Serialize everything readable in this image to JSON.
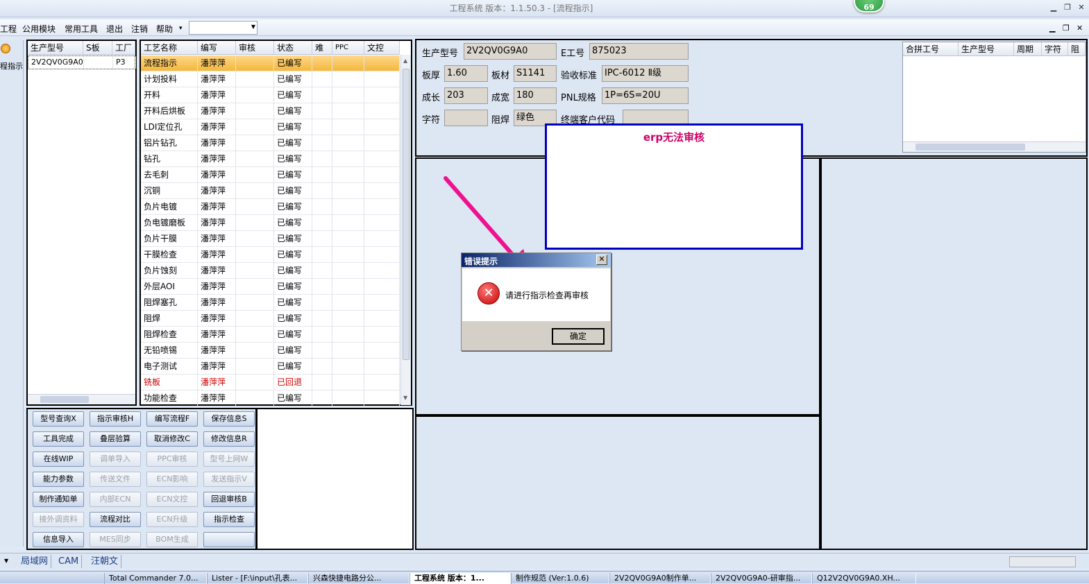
{
  "window": {
    "title": "工程系统   版本：1.1.50.3 - [流程指示]",
    "badge": "69"
  },
  "menu": {
    "items": [
      "工程",
      "公用模块",
      "常用工具",
      "退出",
      "注销",
      "帮助"
    ],
    "help_arrow": "▾"
  },
  "left_strip": {
    "label": "程指示"
  },
  "product_grid": {
    "columns": [
      "生产型号",
      "S板",
      "工厂"
    ],
    "rows": [
      [
        "2V2QV0G9A0",
        "",
        "P3"
      ]
    ]
  },
  "process_grid": {
    "columns": [
      "工艺名称",
      "编写",
      "审核",
      "状态",
      "难",
      "PPC",
      "文控"
    ],
    "rows": [
      {
        "name": "流程指示",
        "writer": "潘萍萍",
        "status": "已编写",
        "selected": true
      },
      {
        "name": "计划投料",
        "writer": "潘萍萍",
        "status": "已编写"
      },
      {
        "name": "开料",
        "writer": "潘萍萍",
        "status": "已编写"
      },
      {
        "name": "开料后烘板",
        "writer": "潘萍萍",
        "status": "已编写"
      },
      {
        "name": "LDI定位孔",
        "writer": "潘萍萍",
        "status": "已编写"
      },
      {
        "name": "铝片钻孔",
        "writer": "潘萍萍",
        "status": "已编写"
      },
      {
        "name": "钻孔",
        "writer": "潘萍萍",
        "status": "已编写"
      },
      {
        "name": "去毛刺",
        "writer": "潘萍萍",
        "status": "已编写"
      },
      {
        "name": "沉铜",
        "writer": "潘萍萍",
        "status": "已编写"
      },
      {
        "name": "负片电镀",
        "writer": "潘萍萍",
        "status": "已编写"
      },
      {
        "name": "负电镀磨板",
        "writer": "潘萍萍",
        "status": "已编写"
      },
      {
        "name": "负片干膜",
        "writer": "潘萍萍",
        "status": "已编写"
      },
      {
        "name": "干膜检查",
        "writer": "潘萍萍",
        "status": "已编写"
      },
      {
        "name": "负片蚀刻",
        "writer": "潘萍萍",
        "status": "已编写"
      },
      {
        "name": "外层AOI",
        "writer": "潘萍萍",
        "status": "已编写"
      },
      {
        "name": "阻焊塞孔",
        "writer": "潘萍萍",
        "status": "已编写"
      },
      {
        "name": "阻焊",
        "writer": "潘萍萍",
        "status": "已编写"
      },
      {
        "name": "阻焊检查",
        "writer": "潘萍萍",
        "status": "已编写"
      },
      {
        "name": "无铅喷锡",
        "writer": "潘萍萍",
        "status": "已编写"
      },
      {
        "name": "电子测试",
        "writer": "潘萍萍",
        "status": "已编写"
      },
      {
        "name": "铣板",
        "writer": "潘萍萍",
        "status": "已回退",
        "returned": true
      },
      {
        "name": "功能检查",
        "writer": "潘萍萍",
        "status": "已编写"
      }
    ]
  },
  "buttons": [
    {
      "label": "型号查询X",
      "enabled": true
    },
    {
      "label": "指示审核H",
      "enabled": true
    },
    {
      "label": "编写流程F",
      "enabled": true
    },
    {
      "label": "保存信息S",
      "enabled": true
    },
    {
      "label": "工具完成",
      "enabled": true
    },
    {
      "label": "叠层验算",
      "enabled": true
    },
    {
      "label": "取消修改C",
      "enabled": true
    },
    {
      "label": "修改信息R",
      "enabled": true
    },
    {
      "label": "在线WIP",
      "enabled": true
    },
    {
      "label": "调单导入",
      "enabled": false
    },
    {
      "label": "PPC审核",
      "enabled": false
    },
    {
      "label": "型号上网W",
      "enabled": false
    },
    {
      "label": "能力参数",
      "enabled": true
    },
    {
      "label": "传送文件",
      "enabled": false
    },
    {
      "label": "ECN影响",
      "enabled": false
    },
    {
      "label": "发送指示V",
      "enabled": false
    },
    {
      "label": "制作通知单",
      "enabled": true
    },
    {
      "label": "内部ECN",
      "enabled": false
    },
    {
      "label": "ECN文控",
      "enabled": false
    },
    {
      "label": "回退审核B",
      "enabled": true
    },
    {
      "label": "接外调资料",
      "enabled": false
    },
    {
      "label": "流程对比",
      "enabled": true
    },
    {
      "label": "ECN升级",
      "enabled": false
    },
    {
      "label": "指示检查",
      "enabled": true
    },
    {
      "label": "信息导入",
      "enabled": true
    },
    {
      "label": "MES同步",
      "enabled": false
    },
    {
      "label": "BOM生成",
      "enabled": false
    },
    {
      "label": "",
      "enabled": true
    }
  ],
  "info": {
    "model_label": "生产型号",
    "model_value": "2V2QV0G9A0",
    "e_label": "E工号",
    "e_value": "875023",
    "thickness_label": "板厚",
    "thickness_value": "1.60",
    "material_label": "板材",
    "material_value": "S1141",
    "standard_label": "验收标准",
    "standard_value": "IPC-6012 Ⅱ级",
    "length_label": "成长",
    "length_value": "203",
    "width_label": "成宽",
    "width_value": "180",
    "pnl_label": "PNL规格",
    "pnl_value": "1P=6S=20U",
    "char_label": "字符",
    "char_value": "",
    "mask_label": "阻焊",
    "mask_value": "绿色",
    "customer_label": "终端客户代码",
    "customer_value": ""
  },
  "merge_grid": {
    "columns": [
      "合拼工号",
      "生产型号",
      "周期",
      "字符",
      "阻焊"
    ]
  },
  "annotation": {
    "text": "erp无法审核",
    "color": "#cc0066"
  },
  "dialog": {
    "title": "错误提示",
    "message": "请进行指示检查再审核",
    "ok_label": "确定",
    "close_glyph": "✕"
  },
  "statusbar": {
    "tabs": [
      "局域网",
      "CAM",
      "汪朝文"
    ]
  },
  "taskbar": {
    "items": [
      {
        "label": "Total Commander 7.0..."
      },
      {
        "label": "Lister - [F:\\input\\孔表..."
      },
      {
        "label": "兴森快捷电路分公..."
      },
      {
        "label": "工程系统   版本：1...",
        "active": true
      },
      {
        "label": "制作规范 (Ver:1.0.6)"
      },
      {
        "label": "2V2QV0G9A0制作单..."
      },
      {
        "label": "2V2QV0G9A0-研审指..."
      },
      {
        "label": "Q12V2QV0G9A0.XH..."
      }
    ]
  }
}
